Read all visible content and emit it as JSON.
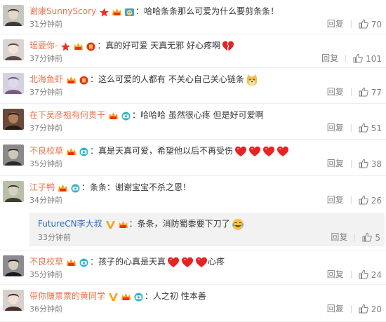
{
  "colors": {
    "username": "#eb7350",
    "username_verified": "#2f6dc1",
    "text": "#333333",
    "meta": "#808080",
    "reply_bg": "#f2f2f2"
  },
  "comments": [
    {
      "user": "谢康SunnyScory",
      "text": "哈哈条条那么可爱为什么要剪条条！",
      "time": "31分钟前",
      "reply": "回复",
      "likes": "70",
      "badges": [
        "star",
        "crown",
        "cat"
      ],
      "emoji": []
    },
    {
      "user": "瑶要你-",
      "text": "真的好可爱 天真无邪 好心疼啊",
      "time": "37分钟前",
      "reply": "回复",
      "likes": "101",
      "badges": [
        "star",
        "crown",
        "red"
      ],
      "emoji": [
        "broken-heart"
      ]
    },
    {
      "user": "北海鱼虾",
      "text": "这么可爱的人都有 不关心自己关心链条",
      "time": "37分钟前",
      "reply": "回复",
      "likes": "77",
      "badges": [
        "crown",
        "red"
      ],
      "emoji": [
        "doge"
      ]
    },
    {
      "user": "在下吴彦祖有何贵干",
      "text": "哈哈哈 虽然很心疼 但是好可爱啊",
      "time": "37分钟前",
      "reply": "回复",
      "likes": "51",
      "badges": [
        "crown",
        "camera"
      ],
      "emoji": []
    },
    {
      "user": "不良校草",
      "text": "真是天真可爱，希望他以后不再受伤",
      "time": "35分钟前",
      "reply": "回复",
      "likes": "38",
      "badges": [
        "crown",
        "camera"
      ],
      "emoji": [
        "heart",
        "heart",
        "heart",
        "heart"
      ]
    },
    {
      "user": "江子鸭",
      "text": "条条：谢谢宝宝不杀之恩！",
      "time": "34分钟前",
      "reply": "回复",
      "likes": "26",
      "badges": [
        "crown",
        "camera"
      ],
      "emoji": []
    },
    {
      "user": "不良校草",
      "text": "孩子的心真是天真",
      "text_after": "心疼",
      "time": "35分钟前",
      "reply": "回复",
      "likes": "24",
      "badges": [
        "crown",
        "camera"
      ],
      "emoji": [
        "heart",
        "heart",
        "heart"
      ]
    },
    {
      "user": "带你赚票票的黄同学",
      "text": "人之初 性本善",
      "time": "36分钟前",
      "reply": "回复",
      "likes": "20",
      "badges": [
        "v",
        "crown",
        "camera"
      ],
      "emoji": []
    }
  ],
  "nested_reply": {
    "user": "FutureCN李大叔",
    "text": "条条，消防蜀黍要下刀了",
    "time": "33分钟前",
    "reply": "回复",
    "likes": "5",
    "badges": [
      "v",
      "crown"
    ],
    "emoji": [
      "laugh-cry"
    ]
  },
  "icons": {
    "like": "thumbs-up-icon",
    "star": "star-badge-icon",
    "crown": "member-crown-icon",
    "camera": "camera-badge-icon",
    "v": "verified-v-icon"
  }
}
